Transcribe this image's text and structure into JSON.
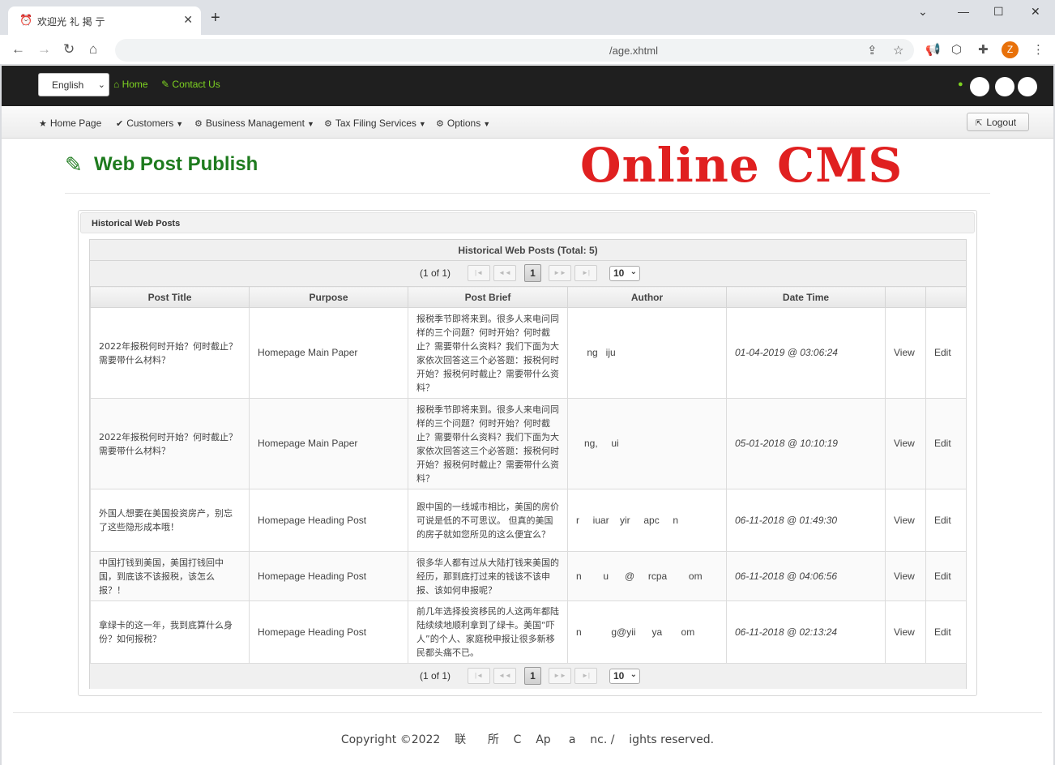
{
  "browser": {
    "tab_title": "欢迎光  礼   掲    亍",
    "url_tail": "/age.xhtml",
    "profile_initial": "Z"
  },
  "appbar": {
    "language": "English",
    "home_label": "Home",
    "contact_label": "Contact Us"
  },
  "menu": {
    "home_page": "Home Page",
    "customers": "Customers",
    "business_management": "Business Management",
    "tax_filing_services": "Tax Filing Services",
    "options": "Options",
    "logout": "Logout"
  },
  "page": {
    "title": "Web Post Publish",
    "banner": "Online CMS"
  },
  "panel": {
    "header": "Historical Web Posts",
    "caption": "Historical Web Posts (Total: 5)",
    "page_report": "(1 of 1)",
    "current_page": "1",
    "rows_per_page": "10",
    "columns": [
      "Post Title",
      "Purpose",
      "Post Brief",
      "Author",
      "Date Time",
      "",
      ""
    ],
    "rows": [
      {
        "title": "2022年报税何时开始？何时截止？需要带什么材料？",
        "purpose": "Homepage Main Paper",
        "brief": "报税季节即将来到。很多人来电问同样的三个问题？何时开始？何时截止？需要带什么资料？我们下面为大家依次回答这三个必答题：报税何时开始？报税何时截止？需要带什么资料？",
        "author": "    ng   iju",
        "datetime": "01-04-2019 @ 03:06:24",
        "view": "View",
        "edit": "Edit"
      },
      {
        "title": "2022年报税何时开始？何时截止？需要带什么材料？",
        "purpose": "Homepage Main Paper",
        "brief": "报税季节即将来到。很多人来电问同样的三个问题？何时开始？何时截止？需要带什么资料？我们下面为大家依次回答这三个必答题：报税何时开始？报税何时截止？需要带什么资料？",
        "author": "   ng,     ui",
        "datetime": "05-01-2018 @ 10:10:19",
        "view": "View",
        "edit": "Edit"
      },
      {
        "title": "外国人想要在美国投资房产，别忘了这些隐形成本哦！",
        "purpose": "Homepage Heading Post",
        "brief": "跟中国的一线城市相比，美国的房价可说是低的不可思议。 但真的美国的房子就如您所见的这么便宜么？",
        "author": "r     iuar    yir     apc     n",
        "datetime": "06-11-2018 @ 01:49:30",
        "view": "View",
        "edit": "Edit"
      },
      {
        "title": "中国打钱到美国，美国打钱回中国，到底该不该报税，该怎么报？！",
        "purpose": "Homepage Heading Post",
        "brief": "很多华人都有过从大陆打钱来美国的经历，那到底打过来的钱该不该申报、该如何申报呢？",
        "author": "n        u      @     rcpa        om",
        "datetime": "06-11-2018 @ 04:06:56",
        "view": "View",
        "edit": "Edit"
      },
      {
        "title": "拿绿卡的这一年，我到底算什么身份？如何报税？",
        "purpose": "Homepage Heading Post",
        "brief": "前几年选择投资移民的人这两年都陆陆续续地顺利拿到了绿卡。美国“吓人”的个人、家庭税申报让很多新移民都头痛不已。",
        "author": "n           g@yii      ya       om",
        "datetime": "06-11-2018 @ 02:13:24",
        "view": "View",
        "edit": "Edit"
      }
    ]
  },
  "footer": {
    "text": "Copyright ©2022    联      所    C    Ap     a    nc. /    ights reserved."
  },
  "colors": {
    "accent_green": "#1e7b1e",
    "link_green": "#7ed321",
    "banner_red": "#e02020",
    "appbar_bg": "#1f1f1f"
  },
  "icons": {
    "home": "home-icon",
    "contact": "edit-icon",
    "user": "user-icon",
    "title": "edit-square-icon",
    "logout": "external-link-icon"
  }
}
